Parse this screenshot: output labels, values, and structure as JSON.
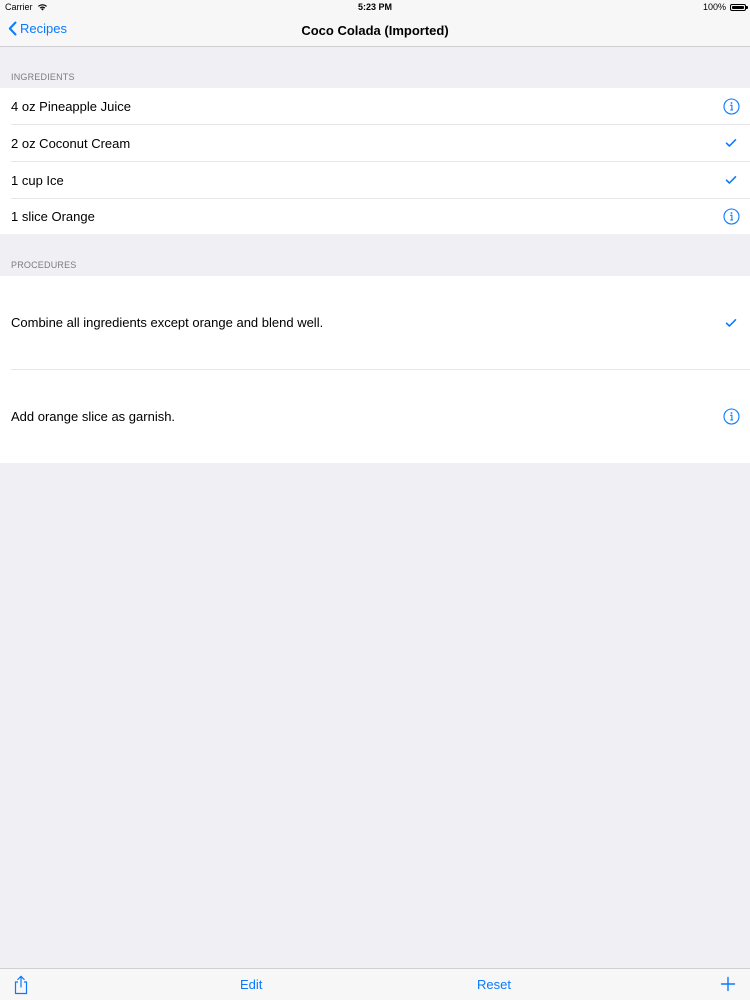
{
  "status_bar": {
    "carrier": "Carrier",
    "time": "5:23 PM",
    "battery": "100%",
    "battery_level": 1.0
  },
  "nav": {
    "back_label": "Recipes",
    "title": "Coco Colada (Imported)"
  },
  "ingredients": {
    "header": "INGREDIENTS",
    "items": [
      {
        "label": "4 oz Pineapple Juice",
        "accessory": "info-icon"
      },
      {
        "label": "2 oz Coconut Cream",
        "accessory": "checkmark-icon"
      },
      {
        "label": "1 cup Ice",
        "accessory": "checkmark-icon"
      },
      {
        "label": "1 slice Orange",
        "accessory": "info-icon"
      }
    ]
  },
  "procedures": {
    "header": "PROCEDURES",
    "items": [
      {
        "label": "Combine all ingredients except orange and blend well.",
        "accessory": "checkmark-icon"
      },
      {
        "label": "Add orange slice as garnish.",
        "accessory": "info-icon"
      }
    ]
  },
  "toolbar": {
    "share_icon": "share-icon",
    "edit_label": "Edit",
    "reset_label": "Reset",
    "add_icon": "plus-icon"
  },
  "colors": {
    "accent": "#0a7aff",
    "background": "#efeff4"
  }
}
